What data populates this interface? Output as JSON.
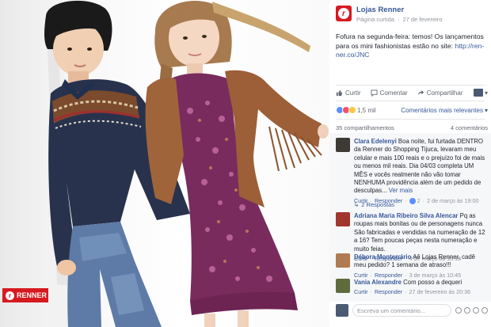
{
  "photo": {
    "brand_tag": "RENNER"
  },
  "post": {
    "page_name": "Lojas Renner",
    "page_type": "Página curtida",
    "date": "27 de fevereiro",
    "text": "Fofura na segunda-feira: temos! Os lançamentos para os mini fashionistas estão no site:",
    "link": "http://ren-ner.co/JNC"
  },
  "actions": {
    "like": "Curtir",
    "comment": "Comentar",
    "share": "Compartilhar"
  },
  "reactions": {
    "count": "1,5 mil",
    "sort_label": "Comentários mais relevantes"
  },
  "counts": {
    "shares": "35 compartilhamentos",
    "comments": "4 comentários"
  },
  "comments": [
    {
      "author": "Clara Edelenyi",
      "text": "Boa noite, fui furtada DENTRO da Renner do Shopping Tijuca, levaram meu celular e mais 100 reais e o prejuízo foi de mais ou menos mil reais. Dia 04/03 completa UM MÊS e vocês realmente não vão tomar NENHUMA providência além de um pedido de desculpas...",
      "see_more": "Ver mais",
      "like": "Curtir",
      "reply": "Responder",
      "reactions": "2",
      "time": "2 de março às 19:00",
      "replies": "2 Respostas"
    },
    {
      "author": "Adriana Maria Ribeiro Silva Alencar",
      "text": "Pq as roupas mais bonitas ou de personagens nunca São fabricadas e vendidas na numeração de 12 a 16? Tem poucas peças nesta numeração e muito feias.",
      "like": "Curtir",
      "reply": "Responder",
      "time": "4 de março às 15:15"
    },
    {
      "author": "Débora Monterrário",
      "text": "Aê Lojas Renner, cadê meu pedido? 1 semana de atraso!!!",
      "like": "Curtir",
      "reply": "Responder",
      "time": "3 de março às 10:45"
    },
    {
      "author": "Vania Alexandre",
      "text": "Com posso a dequeri",
      "like": "Curtir",
      "reply": "Responder",
      "time": "27 de fevereiro às 20:36"
    }
  ],
  "composer": {
    "placeholder": "Escreva um comentário..."
  },
  "colors": {
    "brand_red": "#d71920",
    "facebook_link": "#365899",
    "meta_gray": "#90949c"
  }
}
